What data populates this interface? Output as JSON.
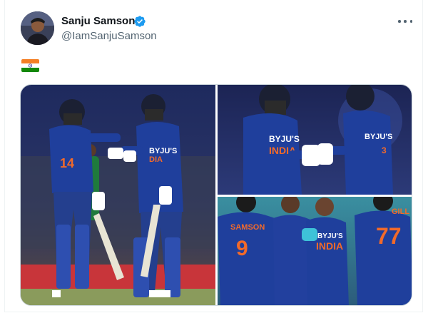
{
  "tweet": {
    "display_name": "Sanju Samson",
    "handle": "@IamSanjuSamson",
    "verified_icon": "verified-badge-icon",
    "more_icon": "more-options-icon",
    "flag_icon": "india-flag-emoji"
  },
  "photos": {
    "photo_1_alt": "Cricketers in India blue kit touching gloves at the crease",
    "photo_2_alt": "Two India batters bumping gloves mid-pitch",
    "photo_3_alt": "India team huddle celebrating a wicket"
  },
  "photo_text": {
    "brand": "BYJU'S",
    "country": "INDIA",
    "jersey_name_1": "SAMSON",
    "jersey_number_1": "9",
    "jersey_name_2": "GILL",
    "jersey_number_2": "77"
  },
  "colors": {
    "verified_blue": "#1d9bf0",
    "jersey_blue": "#1f3f9c",
    "jersey_orange": "#f26a2a",
    "handle_gray": "#536471"
  }
}
